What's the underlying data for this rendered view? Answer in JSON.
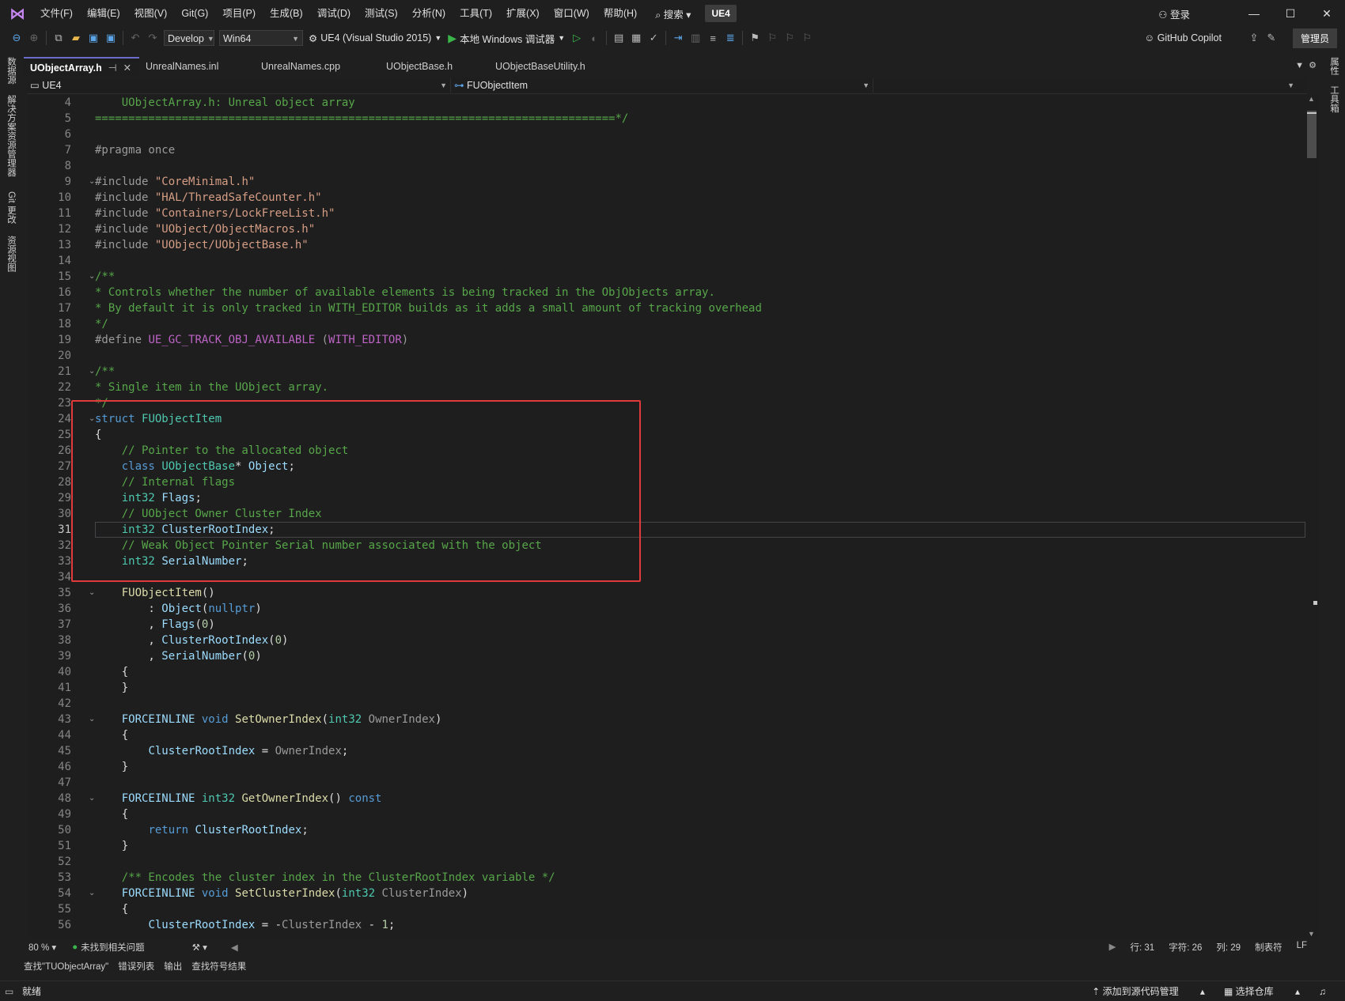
{
  "menubar": {
    "items": [
      "文件(F)",
      "编辑(E)",
      "视图(V)",
      "Git(G)",
      "项目(P)",
      "生成(B)",
      "调试(D)",
      "测试(S)",
      "分析(N)",
      "工具(T)",
      "扩展(X)",
      "窗口(W)",
      "帮助(H)"
    ],
    "search": "搜索",
    "solution": "UE4",
    "login": "登录"
  },
  "toolbar": {
    "config": "Develop",
    "platform": "Win64",
    "project": "UE4 (Visual Studio 2015)",
    "debugger": "本地 Windows 调试器",
    "copilot": "GitHub Copilot",
    "admin": "管理员"
  },
  "left_rail": [
    "数据源",
    "解决方案资源管理器",
    "Git 更改",
    "资源视图"
  ],
  "right_rail": [
    "属性",
    "工具箱"
  ],
  "tabs": [
    {
      "label": "UObjectArray.h",
      "active": true
    },
    {
      "label": "UnrealNames.inl",
      "active": false
    },
    {
      "label": "UnrealNames.cpp",
      "active": false
    },
    {
      "label": "UObjectBase.h",
      "active": false
    },
    {
      "label": "UObjectBaseUtility.h",
      "active": false
    }
  ],
  "navbar": {
    "project": "UE4",
    "scope": "FUObjectItem"
  },
  "editor": {
    "current_line": 31,
    "lines": [
      {
        "n": "4",
        "fold": "",
        "html": "    <span class='c'>UObjectArray.h: Unreal object array</span>"
      },
      {
        "n": "5",
        "fold": "",
        "html": "<span class='c'>==============================================================================*/</span>"
      },
      {
        "n": "6",
        "fold": "",
        "html": ""
      },
      {
        "n": "7",
        "fold": "",
        "html": "<span class='p'>#pragma once</span>"
      },
      {
        "n": "8",
        "fold": "",
        "html": ""
      },
      {
        "n": "9",
        "fold": "v",
        "html": "<span class='p'>#include</span> <span class='s'>\"CoreMinimal.h\"</span>"
      },
      {
        "n": "10",
        "fold": "",
        "html": "<span class='p'>#include</span> <span class='s'>\"HAL/ThreadSafeCounter.h\"</span>"
      },
      {
        "n": "11",
        "fold": "",
        "html": "<span class='p'>#include</span> <span class='s'>\"Containers/LockFreeList.h\"</span>"
      },
      {
        "n": "12",
        "fold": "",
        "html": "<span class='p'>#include</span> <span class='s'>\"UObject/ObjectMacros.h\"</span>"
      },
      {
        "n": "13",
        "fold": "",
        "html": "<span class='p'>#include</span> <span class='s'>\"UObject/UObjectBase.h\"</span>"
      },
      {
        "n": "14",
        "fold": "",
        "html": ""
      },
      {
        "n": "15",
        "fold": "v",
        "html": "<span class='c'>/**</span>"
      },
      {
        "n": "16",
        "fold": "",
        "html": "<span class='c'>* Controls whether the number of available elements is being tracked in the ObjObjects array.</span>"
      },
      {
        "n": "17",
        "fold": "",
        "html": "<span class='c'>* By default it is only tracked in WITH_EDITOR builds as it adds a small amount of tracking overhead</span>"
      },
      {
        "n": "18",
        "fold": "",
        "html": "<span class='c'>*/</span>"
      },
      {
        "n": "19",
        "fold": "",
        "html": "<span class='p'>#define</span> <span class='m'>UE_GC_TRACK_OBJ_AVAILABLE</span> <span class='g'>(</span><span class='m'>WITH_EDITOR</span><span class='g'>)</span>"
      },
      {
        "n": "20",
        "fold": "",
        "html": ""
      },
      {
        "n": "21",
        "fold": "v",
        "html": "<span class='c'>/**</span>"
      },
      {
        "n": "22",
        "fold": "",
        "html": "<span class='c'>* Single item in the UObject array.</span>"
      },
      {
        "n": "23",
        "fold": "",
        "html": "<span class='c'>*/</span>"
      },
      {
        "n": "24",
        "fold": "v",
        "html": "<span class='k'>struct</span> <span class='t'>FUObjectItem</span>"
      },
      {
        "n": "25",
        "fold": "",
        "html": "{"
      },
      {
        "n": "26",
        "fold": "",
        "html": "    <span class='c'>// Pointer to the allocated object</span>"
      },
      {
        "n": "27",
        "fold": "",
        "html": "    <span class='k'>class</span> <span class='t'>UObjectBase</span>* <span class='v'>Object</span>;"
      },
      {
        "n": "28",
        "fold": "",
        "html": "    <span class='c'>// Internal flags</span>"
      },
      {
        "n": "29",
        "fold": "",
        "html": "    <span class='t'>int32</span> <span class='v'>Flags</span>;"
      },
      {
        "n": "30",
        "fold": "",
        "html": "    <span class='c'>// UObject Owner Cluster Index</span>"
      },
      {
        "n": "31",
        "fold": "",
        "html": "    <span class='t'>int32</span> <span class='v'>ClusterRootIndex</span>;"
      },
      {
        "n": "32",
        "fold": "",
        "html": "    <span class='c'>// Weak Object Pointer Serial number associated with the object</span>"
      },
      {
        "n": "33",
        "fold": "",
        "html": "    <span class='t'>int32</span> <span class='v'>SerialNumber</span>;"
      },
      {
        "n": "34",
        "fold": "",
        "html": ""
      },
      {
        "n": "35",
        "fold": "v",
        "html": "    <span class='f'>FUObjectItem</span>()"
      },
      {
        "n": "36",
        "fold": "",
        "html": "        : <span class='v'>Object</span>(<span class='k'>nullptr</span>)"
      },
      {
        "n": "37",
        "fold": "",
        "html": "        , <span class='v'>Flags</span>(<span class='n'>0</span>)"
      },
      {
        "n": "38",
        "fold": "",
        "html": "        , <span class='v'>ClusterRootIndex</span>(<span class='n'>0</span>)"
      },
      {
        "n": "39",
        "fold": "",
        "html": "        , <span class='v'>SerialNumber</span>(<span class='n'>0</span>)"
      },
      {
        "n": "40",
        "fold": "",
        "html": "    {"
      },
      {
        "n": "41",
        "fold": "",
        "html": "    }"
      },
      {
        "n": "42",
        "fold": "",
        "html": ""
      },
      {
        "n": "43",
        "fold": "v",
        "html": "    <span class='v'>FORCEINLINE</span> <span class='k'>void</span> <span class='f'>SetOwnerIndex</span>(<span class='t'>int32</span> <span class='g'>OwnerIndex</span>)"
      },
      {
        "n": "44",
        "fold": "",
        "html": "    {"
      },
      {
        "n": "45",
        "fold": "",
        "html": "        <span class='v'>ClusterRootIndex</span> = <span class='g'>OwnerIndex</span>;"
      },
      {
        "n": "46",
        "fold": "",
        "html": "    }"
      },
      {
        "n": "47",
        "fold": "",
        "html": ""
      },
      {
        "n": "48",
        "fold": "v",
        "html": "    <span class='v'>FORCEINLINE</span> <span class='t'>int32</span> <span class='f'>GetOwnerIndex</span>() <span class='k'>const</span>"
      },
      {
        "n": "49",
        "fold": "",
        "html": "    {"
      },
      {
        "n": "50",
        "fold": "",
        "html": "        <span class='k'>return</span> <span class='v'>ClusterRootIndex</span>;"
      },
      {
        "n": "51",
        "fold": "",
        "html": "    }"
      },
      {
        "n": "52",
        "fold": "",
        "html": ""
      },
      {
        "n": "53",
        "fold": "",
        "html": "    <span class='c'>/** Encodes the cluster index in the ClusterRootIndex variable */</span>"
      },
      {
        "n": "54",
        "fold": "v",
        "html": "    <span class='v'>FORCEINLINE</span> <span class='k'>void</span> <span class='f'>SetClusterIndex</span>(<span class='t'>int32</span> <span class='g'>ClusterIndex</span>)"
      },
      {
        "n": "55",
        "fold": "",
        "html": "    {"
      },
      {
        "n": "56",
        "fold": "",
        "html": "        <span class='v'>ClusterRootIndex</span> = -<span class='g'>ClusterIndex</span> - <span class='n'>1</span>;"
      }
    ]
  },
  "edstatus": {
    "zoom": "80 %",
    "issues": "未找到相关问题",
    "row": "行: 31",
    "char": "字符: 26",
    "col": "列: 29",
    "tabs": "制表符",
    "eol": "LF"
  },
  "outtabs": [
    "查找\"TUObjectArray\"",
    "错误列表",
    "输出",
    "查找符号结果"
  ],
  "statusbar": {
    "ready": "就绪",
    "add_source": "添加到源代码管理",
    "select_repo": "选择仓库"
  }
}
